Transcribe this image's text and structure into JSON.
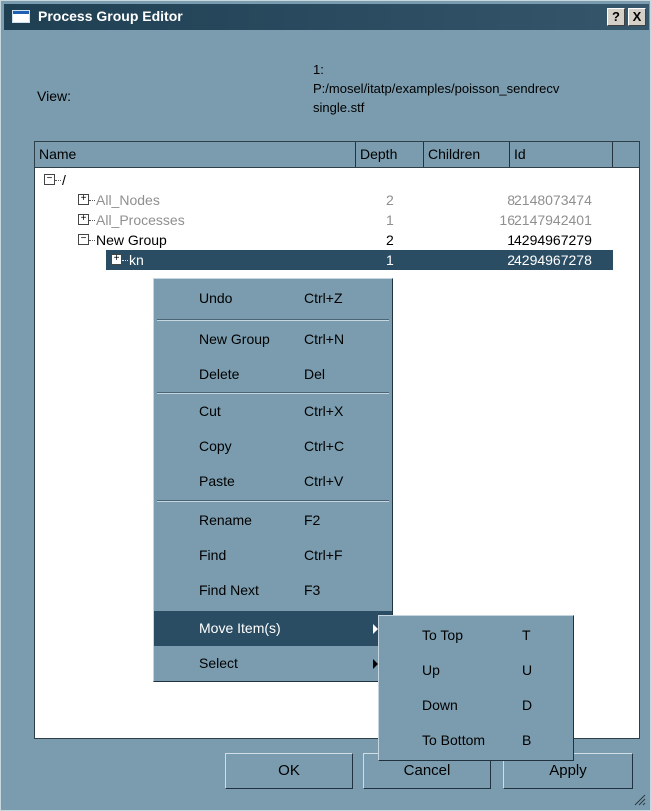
{
  "window": {
    "title": "Process Group Editor",
    "help_label": "?",
    "close_label": "X"
  },
  "view": {
    "label": "View:",
    "lines": [
      "1:",
      "P:/mosel/itatp/examples/poisson_sendrecv",
      "single.stf"
    ]
  },
  "columns": [
    "Name",
    "Depth",
    "Children",
    "Id"
  ],
  "tree": [
    {
      "name": "/",
      "depth": "",
      "children": "",
      "id": "",
      "style": "normal",
      "expander": "−"
    },
    {
      "name": "All_Nodes",
      "depth": "2",
      "children": "8",
      "id": "2148073474",
      "style": "grey",
      "expander": "+"
    },
    {
      "name": "All_Processes",
      "depth": "1",
      "children": "16",
      "id": "2147942401",
      "style": "grey",
      "expander": "+"
    },
    {
      "name": "New Group",
      "depth": "2",
      "children": "1",
      "id": "4294967279",
      "style": "normal",
      "expander": "−"
    },
    {
      "name": "kn",
      "depth": "1",
      "children": "2",
      "id": "4294967278",
      "style": "selected",
      "expander": "+"
    }
  ],
  "context_menu": {
    "items": [
      {
        "label": "Undo",
        "shortcut": "Ctrl+Z"
      },
      {
        "label": "New Group",
        "shortcut": "Ctrl+N"
      },
      {
        "label": "Delete",
        "shortcut": "Del"
      },
      {
        "label": "Cut",
        "shortcut": "Ctrl+X"
      },
      {
        "label": "Copy",
        "shortcut": "Ctrl+C"
      },
      {
        "label": "Paste",
        "shortcut": "Ctrl+V"
      },
      {
        "label": "Rename",
        "shortcut": "F2"
      },
      {
        "label": "Find",
        "shortcut": "Ctrl+F"
      },
      {
        "label": "Find Next",
        "shortcut": "F3"
      },
      {
        "label": "Move Item(s)",
        "shortcut": ""
      },
      {
        "label": "Select",
        "shortcut": ""
      }
    ],
    "highlighted": "Move Item(s)"
  },
  "submenu": {
    "items": [
      {
        "label": "To Top",
        "shortcut": "T"
      },
      {
        "label": "Up",
        "shortcut": "U"
      },
      {
        "label": "Down",
        "shortcut": "D"
      },
      {
        "label": "To Bottom",
        "shortcut": "B"
      }
    ]
  },
  "buttons": {
    "ok": "OK",
    "cancel": "Cancel",
    "apply": "Apply"
  },
  "colors": {
    "window_bg": "#7a9cae",
    "titlebar": "#1f3f53",
    "selection": "#2b4d63",
    "greyed_text": "#8f8f8f"
  }
}
